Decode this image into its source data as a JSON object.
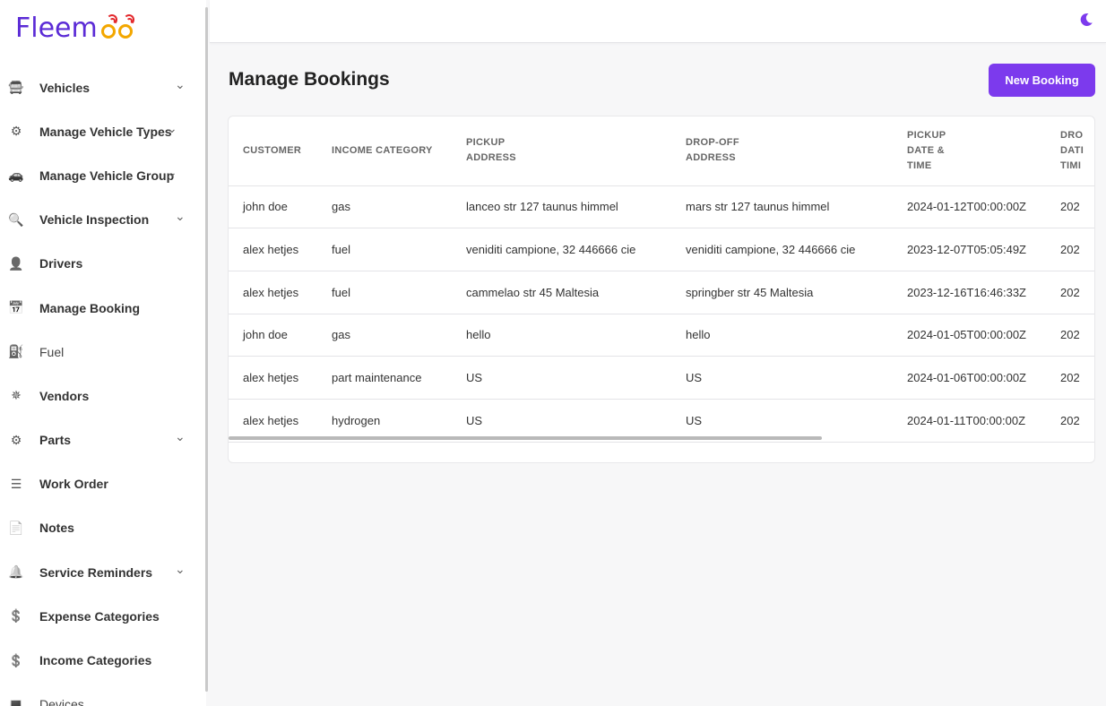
{
  "app": {
    "logo_text": "Fleem"
  },
  "sidebar": {
    "items": [
      {
        "label": "Vehicles",
        "icon": "vehicle-icon",
        "chevron": true
      },
      {
        "label": "Manage Vehicle Types",
        "icon": "steering-icon",
        "chevron": true
      },
      {
        "label": "Manage Vehicle Group",
        "icon": "car-group-icon",
        "chevron": true
      },
      {
        "label": "Vehicle Inspection",
        "icon": "inspection-icon",
        "chevron": true
      },
      {
        "label": "Drivers",
        "icon": "driver-icon",
        "chevron": false
      },
      {
        "label": "Manage Booking",
        "icon": "calendar-icon",
        "chevron": false
      },
      {
        "label": "Fuel",
        "icon": "fuel-icon",
        "chevron": false
      },
      {
        "label": "Vendors",
        "icon": "vendor-icon",
        "chevron": false
      },
      {
        "label": "Parts",
        "icon": "parts-icon",
        "chevron": true
      },
      {
        "label": "Work Order",
        "icon": "list-icon",
        "chevron": false
      },
      {
        "label": "Notes",
        "icon": "notes-icon",
        "chevron": false
      },
      {
        "label": "Service Reminders",
        "icon": "bell-icon",
        "chevron": true
      },
      {
        "label": "Expense Categories",
        "icon": "expense-icon",
        "chevron": false
      },
      {
        "label": "Income Categories",
        "icon": "income-icon",
        "chevron": false
      },
      {
        "label": "Devices",
        "icon": "device-icon",
        "chevron": false
      }
    ]
  },
  "header": {
    "theme_toggle_icon": "moon-icon",
    "accent": "#7c3aed"
  },
  "main": {
    "title": "Manage Bookings",
    "new_button": "New Booking"
  },
  "table": {
    "columns": [
      [
        "CUSTOMER"
      ],
      [
        "INCOME CATEGORY"
      ],
      [
        "PICKUP",
        "ADDRESS"
      ],
      [
        "DROP-OFF",
        "ADDRESS"
      ],
      [
        "PICKUP",
        "DATE &",
        "TIME"
      ],
      [
        "DRO",
        "DATI",
        "TIMI"
      ]
    ],
    "rows": [
      [
        "john doe",
        "gas",
        "lanceo str 127 taunus himmel",
        "mars str 127 taunus himmel",
        "2024-01-12T00:00:00Z",
        "202"
      ],
      [
        "alex hetjes",
        "fuel",
        "veniditi campione, 32 446666 cie",
        "veniditi campione, 32 446666 cie",
        "2023-12-07T05:05:49Z",
        "202"
      ],
      [
        "alex hetjes",
        "fuel",
        "cammelao str 45 Maltesia",
        "springber str 45 Maltesia",
        "2023-12-16T16:46:33Z",
        "202"
      ],
      [
        "john doe",
        "gas",
        "hello",
        "hello",
        "2024-01-05T00:00:00Z",
        "202"
      ],
      [
        "alex hetjes",
        "part maintenance",
        "US",
        "US",
        "2024-01-06T00:00:00Z",
        "202"
      ],
      [
        "alex hetjes",
        "hydrogen",
        "US",
        "US",
        "2024-01-11T00:00:00Z",
        "202"
      ]
    ]
  }
}
